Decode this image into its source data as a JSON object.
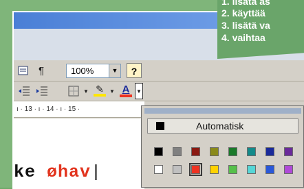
{
  "instructions": [
    "1. lisätä as",
    "2. käyttää",
    "3. lisätä va",
    "4. vaihtaa"
  ],
  "toolbar": {
    "zoom_value": "100%",
    "pilcrow": "¶",
    "help": "?",
    "font_color_glyph": "A",
    "highlight_glyph": "✎"
  },
  "ruler": {
    "text": "ı · 13 · ı · 14 · ı · 15 ·"
  },
  "document": {
    "word1": "ke ",
    "word2": "øhav",
    "caret": "|"
  },
  "palette": {
    "automatic_label": "Automatisk",
    "row1": [
      "#000000",
      "#808080",
      "#8b1a12",
      "#8a8a1a",
      "#1a7a2a",
      "#138a8a",
      "#1a2a9a",
      "#6a2a9a"
    ],
    "row2": [
      "#ffffff",
      "#c0c0c0",
      "#ee3322",
      "#ffd200",
      "#55c04a",
      "#55d6d6",
      "#2a58d8",
      "#b04ad8"
    ],
    "selected": "#ee3322"
  }
}
